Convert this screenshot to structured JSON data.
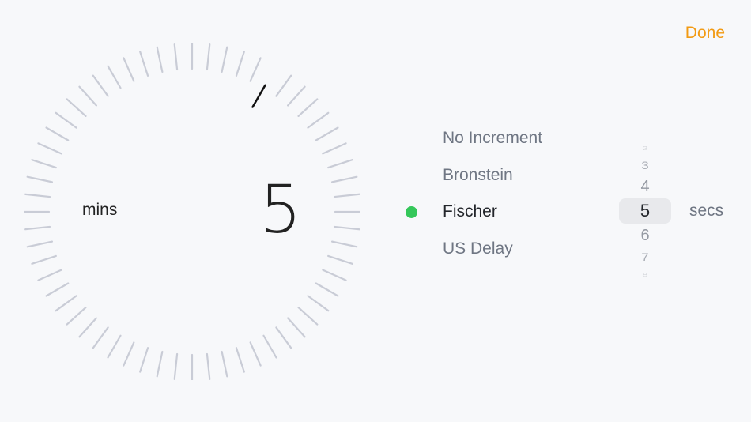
{
  "header": {
    "done_label": "Done"
  },
  "dial": {
    "value": "5",
    "unit_label": "mins",
    "max_value": 60
  },
  "increment_options": [
    {
      "label": "No Increment",
      "selected": false
    },
    {
      "label": "Bronstein",
      "selected": false
    },
    {
      "label": "Fischer",
      "selected": true
    },
    {
      "label": "US Delay",
      "selected": false
    }
  ],
  "increment_picker": {
    "visible_values": [
      "2",
      "3",
      "4",
      "5",
      "6",
      "7",
      "8"
    ],
    "selected_value": "5",
    "unit_label": "secs"
  },
  "colors": {
    "accent": "#f29a12",
    "selected_dot": "#35c75a",
    "tick": "#c9ccd6",
    "active_tick": "#111111"
  }
}
